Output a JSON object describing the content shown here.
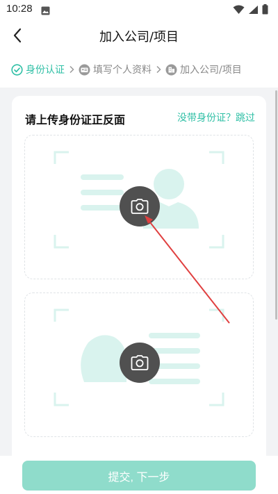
{
  "status_bar": {
    "time": "10:28",
    "icons": [
      "image-icon",
      "wifi-icon",
      "signal-icon",
      "battery-icon"
    ]
  },
  "nav": {
    "title": "加入公司/项目",
    "back_icon": "back-arrow-icon"
  },
  "steps": [
    {
      "label": "身份认证",
      "icon": "check-circle-icon",
      "active": true
    },
    {
      "label": "填写个人资料",
      "icon": "id-card-icon",
      "active": false
    },
    {
      "label": "加入公司/项目",
      "icon": "building-icon",
      "active": false
    }
  ],
  "card": {
    "title": "请上传身份证正反面",
    "skip_link": "没带身份证？跳过",
    "uploads": [
      {
        "side": "front",
        "icon": "camera-icon"
      },
      {
        "side": "back",
        "icon": "camera-icon"
      }
    ]
  },
  "submit_label": "提交, 下一步",
  "colors": {
    "accent": "#2ebfa5",
    "illustration": "#d9f3ee",
    "button_disabled": "#8fdccb",
    "camera_bg": "#505050",
    "annotation_arrow": "#e04040"
  }
}
